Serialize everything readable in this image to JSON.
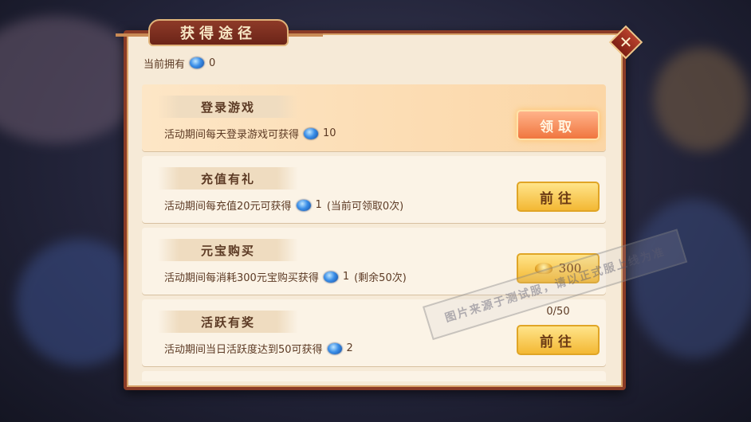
{
  "dialog": {
    "title": "获得途径",
    "close_icon": "close-icon"
  },
  "currency": {
    "label": "当前拥有",
    "icon": "blue-orb-icon",
    "amount": "0"
  },
  "tasks": [
    {
      "name": "登录游戏",
      "desc": "活动期间每天登录游戏可获得",
      "reward": "10",
      "extra": "",
      "button": "领取",
      "button_type": "claim"
    },
    {
      "name": "充值有礼",
      "desc": "活动期间每充值20元可获得",
      "reward": "1",
      "extra": "(当前可领取0次)",
      "button": "前往",
      "button_type": "go"
    },
    {
      "name": "元宝购买",
      "desc": "活动期间每消耗300元宝购买获得",
      "reward": "1",
      "extra": "(剩余50次)",
      "button": "300",
      "button_type": "cost",
      "button_icon": "gold-ingot-icon"
    },
    {
      "name": "活跃有奖",
      "desc": "活动期间当日活跃度达到50可获得",
      "reward": "2",
      "extra": "",
      "progress": "0/50",
      "button": "前往",
      "button_type": "go"
    }
  ],
  "watermark": "图片来源于测试服，请以正式服上线为准",
  "colors": {
    "panel_border": "#8a3b26",
    "claim_button": "#f0763f",
    "go_button": "#f3b834"
  }
}
